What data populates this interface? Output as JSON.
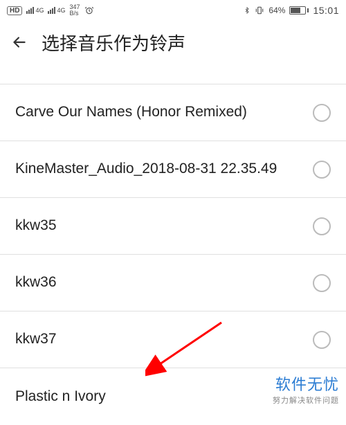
{
  "status_bar": {
    "hd_badge": "HD",
    "signal1_label": "4G",
    "signal2_label": "4G",
    "speed_value": "347",
    "speed_unit": "B/s",
    "battery_percent": "64%",
    "time": "15:01"
  },
  "header": {
    "title": "选择音乐作为铃声"
  },
  "list": {
    "items": [
      {
        "label": "Carve Our Names (Honor Remixed)"
      },
      {
        "label": "KineMaster_Audio_2018-08-31 22.35.49"
      },
      {
        "label": "kkw35"
      },
      {
        "label": "kkw36"
      },
      {
        "label": "kkw37"
      },
      {
        "label": "Plastic n Ivory"
      }
    ]
  },
  "watermark": {
    "main": "软件无忧",
    "sub": "努力解决软件问题"
  },
  "colors": {
    "divider": "#e0e0e0",
    "radio_border": "#bbbbbb",
    "arrow": "#ff0000",
    "watermark_main": "#2b7cd3"
  }
}
